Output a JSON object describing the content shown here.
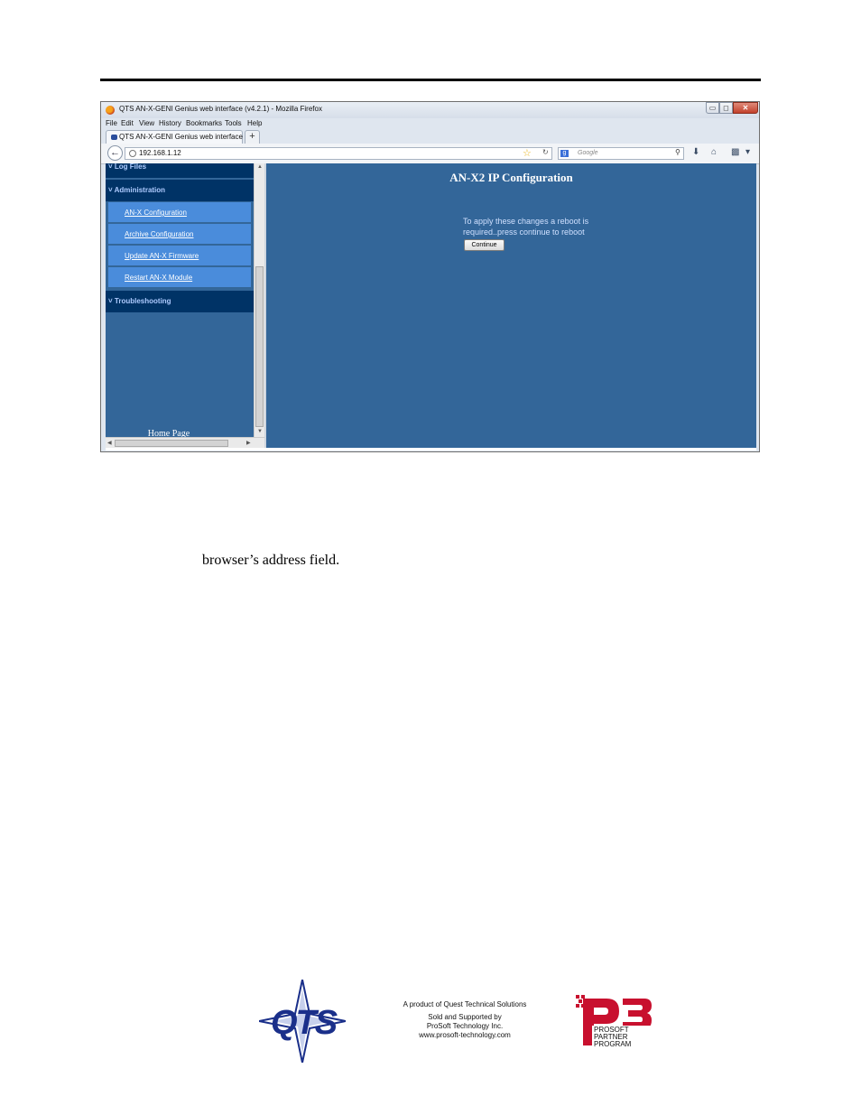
{
  "browser": {
    "window_title": "QTS AN-X-GENI Genius web interface (v4.2.1) - Mozilla Firefox",
    "window_controls": {
      "minimize": "▭",
      "maximize": "◻",
      "close": "✕"
    },
    "menu": [
      "File",
      "Edit",
      "View",
      "History",
      "Bookmarks",
      "Tools",
      "Help"
    ],
    "tab_label": "QTS AN-X-GENI Genius web interface (v...",
    "new_tab": "+",
    "url": "192.168.1.12",
    "search_placeholder": "Google",
    "icons": [
      "back-arrow-icon",
      "globe-icon",
      "star-icon",
      "reload-icon",
      "google-icon",
      "search-icon",
      "download-icon",
      "home-icon",
      "addon-icon",
      "menu-icon"
    ]
  },
  "sidebar": {
    "sections": [
      {
        "label": "Log Files"
      },
      {
        "label": "Administration"
      },
      {
        "label": "Troubleshooting"
      }
    ],
    "admin_items": [
      {
        "label": "AN-X Configuration"
      },
      {
        "label": "Archive Configuration"
      },
      {
        "label": "Update AN-X Firmware"
      },
      {
        "label": "Restart AN-X Module"
      }
    ],
    "home_link": "Home Page"
  },
  "main": {
    "title": "AN-X2 IP Configuration",
    "notice": "To apply these changes a reboot is required..press continue to reboot",
    "continue_label": "Continue"
  },
  "document": {
    "caption": "browser’s address field."
  },
  "footer": {
    "qts_logo_text": "QTS",
    "lines": [
      "A product of Quest Technical Solutions",
      "Sold and Supported by",
      "ProSoft Technology Inc.",
      "www.prosoft-technology.com"
    ],
    "p3_lines": [
      "PROSOFT",
      "PARTNER",
      "PROGRAM"
    ]
  }
}
